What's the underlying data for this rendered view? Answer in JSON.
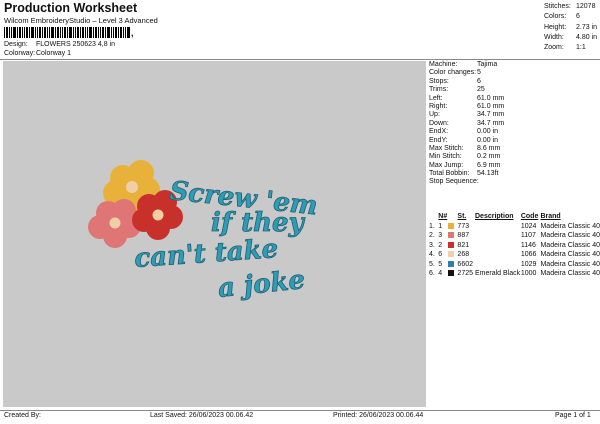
{
  "header": {
    "title": "Production Worksheet",
    "subtitle": "Wilcom EmbroideryStudio – Level 3 Advanced",
    "barcode_suffix": ",",
    "design_label": "Design:",
    "design_value": "FLOWERS 250623 4,8 in",
    "colorway_label": "Colorway:",
    "colorway_value": "Colorway 1"
  },
  "stats": [
    {
      "label": "Stitches:",
      "value": "12078"
    },
    {
      "label": "Colors:",
      "value": "6"
    },
    {
      "label": "Height:",
      "value": "2.73 in"
    },
    {
      "label": "Width:",
      "value": "4.80 in"
    },
    {
      "label": "Zoom:",
      "value": "1:1"
    }
  ],
  "machine_info": [
    {
      "label": "Machine:",
      "value": "Tajima"
    },
    {
      "label": "Color changes:",
      "value": "5"
    },
    {
      "label": "Stops:",
      "value": "6"
    },
    {
      "label": "Trims:",
      "value": "25"
    },
    {
      "label": "Left:",
      "value": "61.0 mm"
    },
    {
      "label": "Right:",
      "value": "61.0 mm"
    },
    {
      "label": "Up:",
      "value": "34.7 mm"
    },
    {
      "label": "Down:",
      "value": "34.7 mm"
    },
    {
      "label": "EndX:",
      "value": "0.00 in"
    },
    {
      "label": "EndY:",
      "value": "0.00 in"
    },
    {
      "label": "Max Stitch:",
      "value": "8.6 mm"
    },
    {
      "label": "Min Stitch:",
      "value": "0.2 mm"
    },
    {
      "label": "Max Jump:",
      "value": "6.9 mm"
    },
    {
      "label": "Total Bobbin:",
      "value": "54.13ft"
    }
  ],
  "stop_sequence": {
    "title": "Stop Sequence:",
    "headers": {
      "n": "N#",
      "st": "St.",
      "description": "Description",
      "code": "Code",
      "brand": "Brand"
    },
    "rows": [
      {
        "stop": "1.",
        "n": "1",
        "color": "#e8b23a",
        "st": "773",
        "description": "",
        "code": "1024",
        "brand": "Madeira Classic 40"
      },
      {
        "stop": "2.",
        "n": "3",
        "color": "#e07575",
        "st": "887",
        "description": "",
        "code": "1107",
        "brand": "Madeira Classic 40"
      },
      {
        "stop": "3.",
        "n": "2",
        "color": "#c8302c",
        "st": "821",
        "description": "",
        "code": "1146",
        "brand": "Madeira Classic 40"
      },
      {
        "stop": "4.",
        "n": "6",
        "color": "#f1cfa6",
        "st": "268",
        "description": "",
        "code": "1066",
        "brand": "Madeira Classic 40"
      },
      {
        "stop": "5.",
        "n": "5",
        "color": "#2e7fb0",
        "st": "6602",
        "description": "",
        "code": "1029",
        "brand": "Madeira Classic 40"
      },
      {
        "stop": "6.",
        "n": "4",
        "color": "#111111",
        "st": "2725",
        "description": "Emerald Black",
        "code": "1000",
        "brand": "Madeira Classic 40"
      }
    ]
  },
  "design_text": {
    "line1": "Screw 'em",
    "line2": "if they",
    "line3": "can't take",
    "line4": "a joke"
  },
  "colors": {
    "canvas": "#c9c9c9",
    "text_fill": "#2f9cb5",
    "text_stroke": "#1f5f73"
  },
  "footer": {
    "created_by": "Created By:",
    "last_saved": "Last Saved: 26/06/2023 00.06.42",
    "printed": "Printed: 26/06/2023 00.06.44",
    "page": "Page 1 of 1"
  }
}
